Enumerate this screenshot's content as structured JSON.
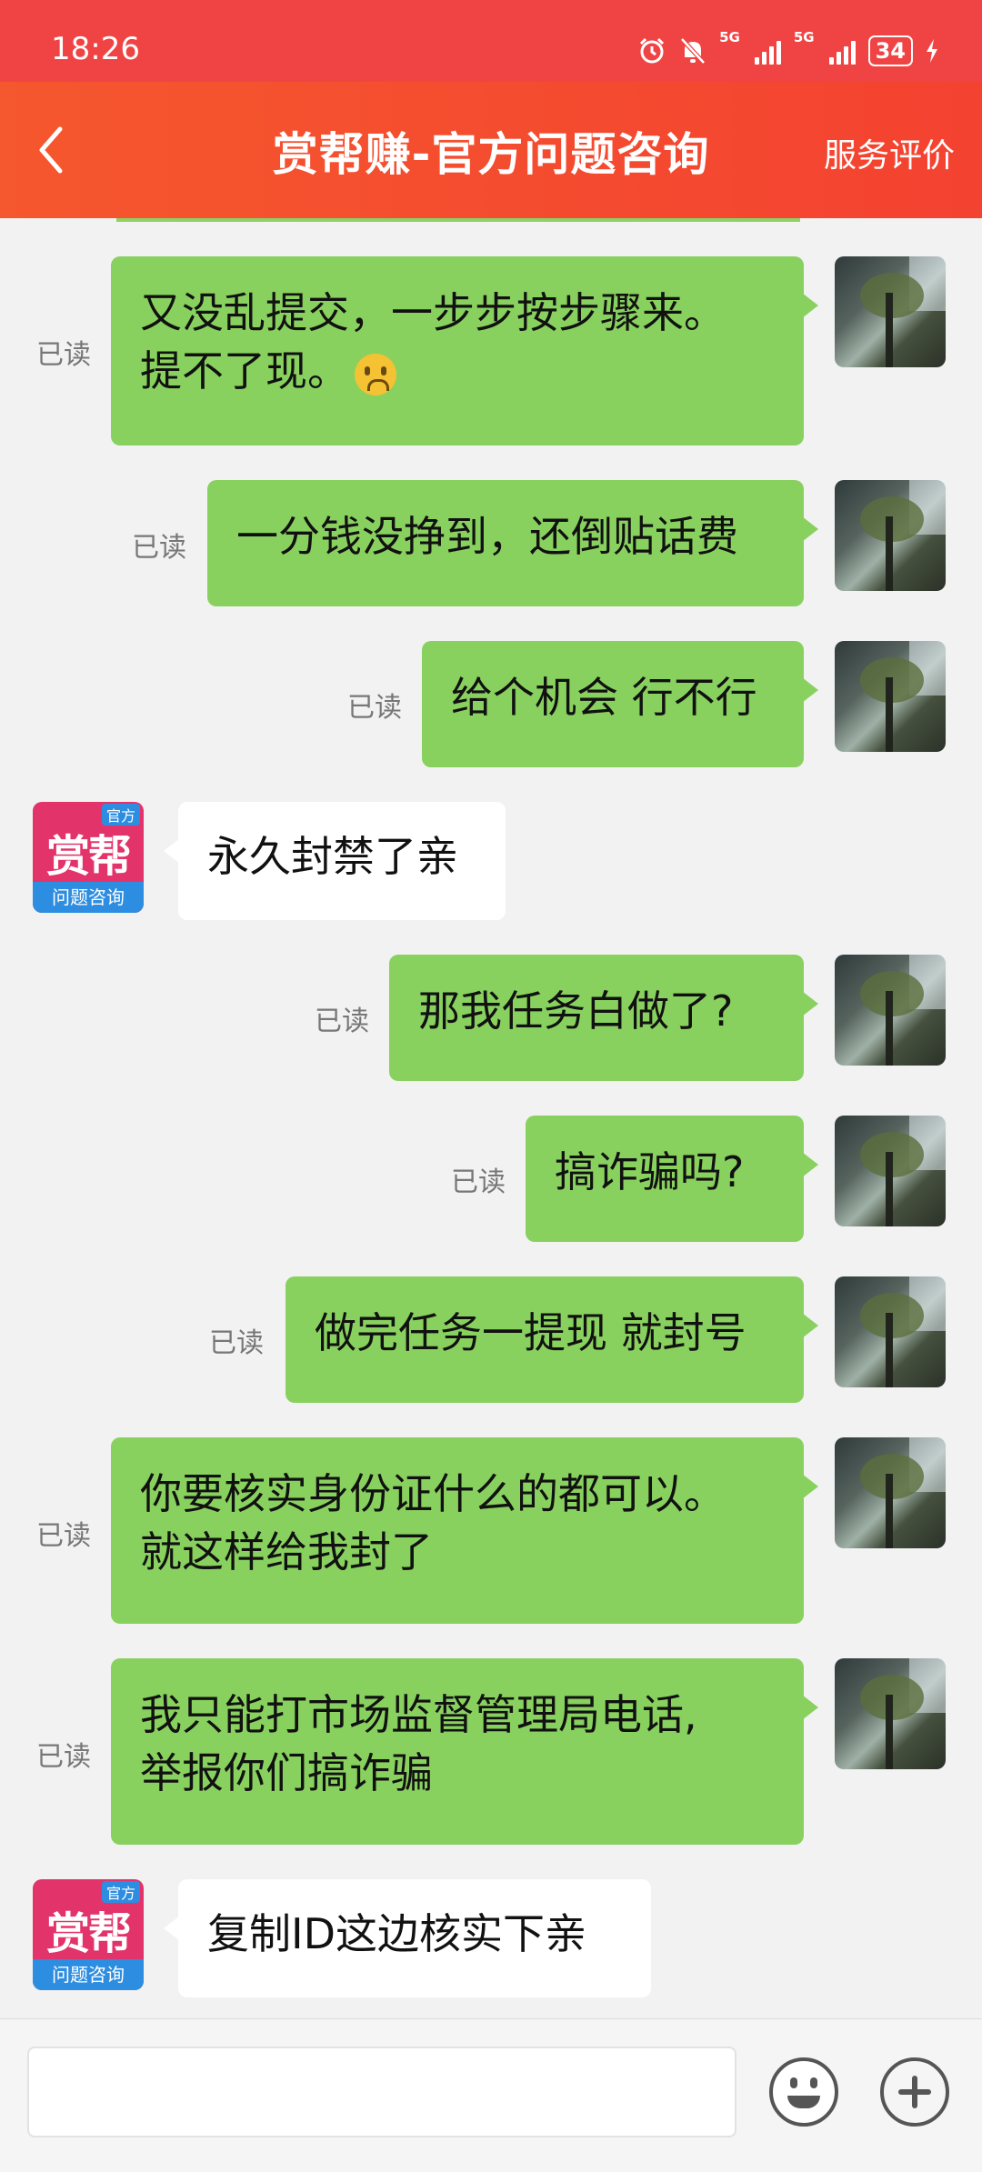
{
  "status_bar": {
    "time": "18:26",
    "network_1": "5G",
    "network_2": "5G",
    "battery": "34",
    "icons": [
      "alarm-icon",
      "mute-icon",
      "signal-icon",
      "signal-icon",
      "battery-icon",
      "charging-icon"
    ]
  },
  "header": {
    "title": "赏帮赚-官方问题咨询",
    "right_action": "服务评价",
    "back_icon": "back-arrow-icon"
  },
  "service_avatar": {
    "big_text": "赏帮",
    "tag": "官方",
    "footer": "问题咨询"
  },
  "messages": [
    {
      "from": "self",
      "status": "已读",
      "line1": "又没乱提交，一步步按步骤来。",
      "line2": "提不了现。",
      "emoji": "crying-face-icon"
    },
    {
      "from": "self",
      "status": "已读",
      "text": "一分钱没挣到，还倒贴话费"
    },
    {
      "from": "self",
      "status": "已读",
      "text": "给个机会 行不行"
    },
    {
      "from": "service",
      "text": "永久封禁了亲"
    },
    {
      "from": "self",
      "status": "已读",
      "text": "那我任务白做了?"
    },
    {
      "from": "self",
      "status": "已读",
      "text": "搞诈骗吗?"
    },
    {
      "from": "self",
      "status": "已读",
      "text": "做完任务一提现 就封号"
    },
    {
      "from": "self",
      "status": "已读",
      "line1": "你要核实身份证什么的都可以。",
      "line2": "就这样给我封了"
    },
    {
      "from": "self",
      "status": "已读",
      "line1": "我只能打市场监督管理局电话,",
      "line2": "举报你们搞诈骗"
    },
    {
      "from": "service",
      "text": "复制ID这边核实下亲"
    }
  ],
  "input_bar": {
    "placeholder": "",
    "emoji_icon": "emoji-icon",
    "plus_icon": "plus-icon"
  },
  "colors": {
    "header_red": "#f44230",
    "self_bubble": "#89d15f",
    "service_bubble": "#ffffff",
    "background": "#f2f2f2"
  }
}
